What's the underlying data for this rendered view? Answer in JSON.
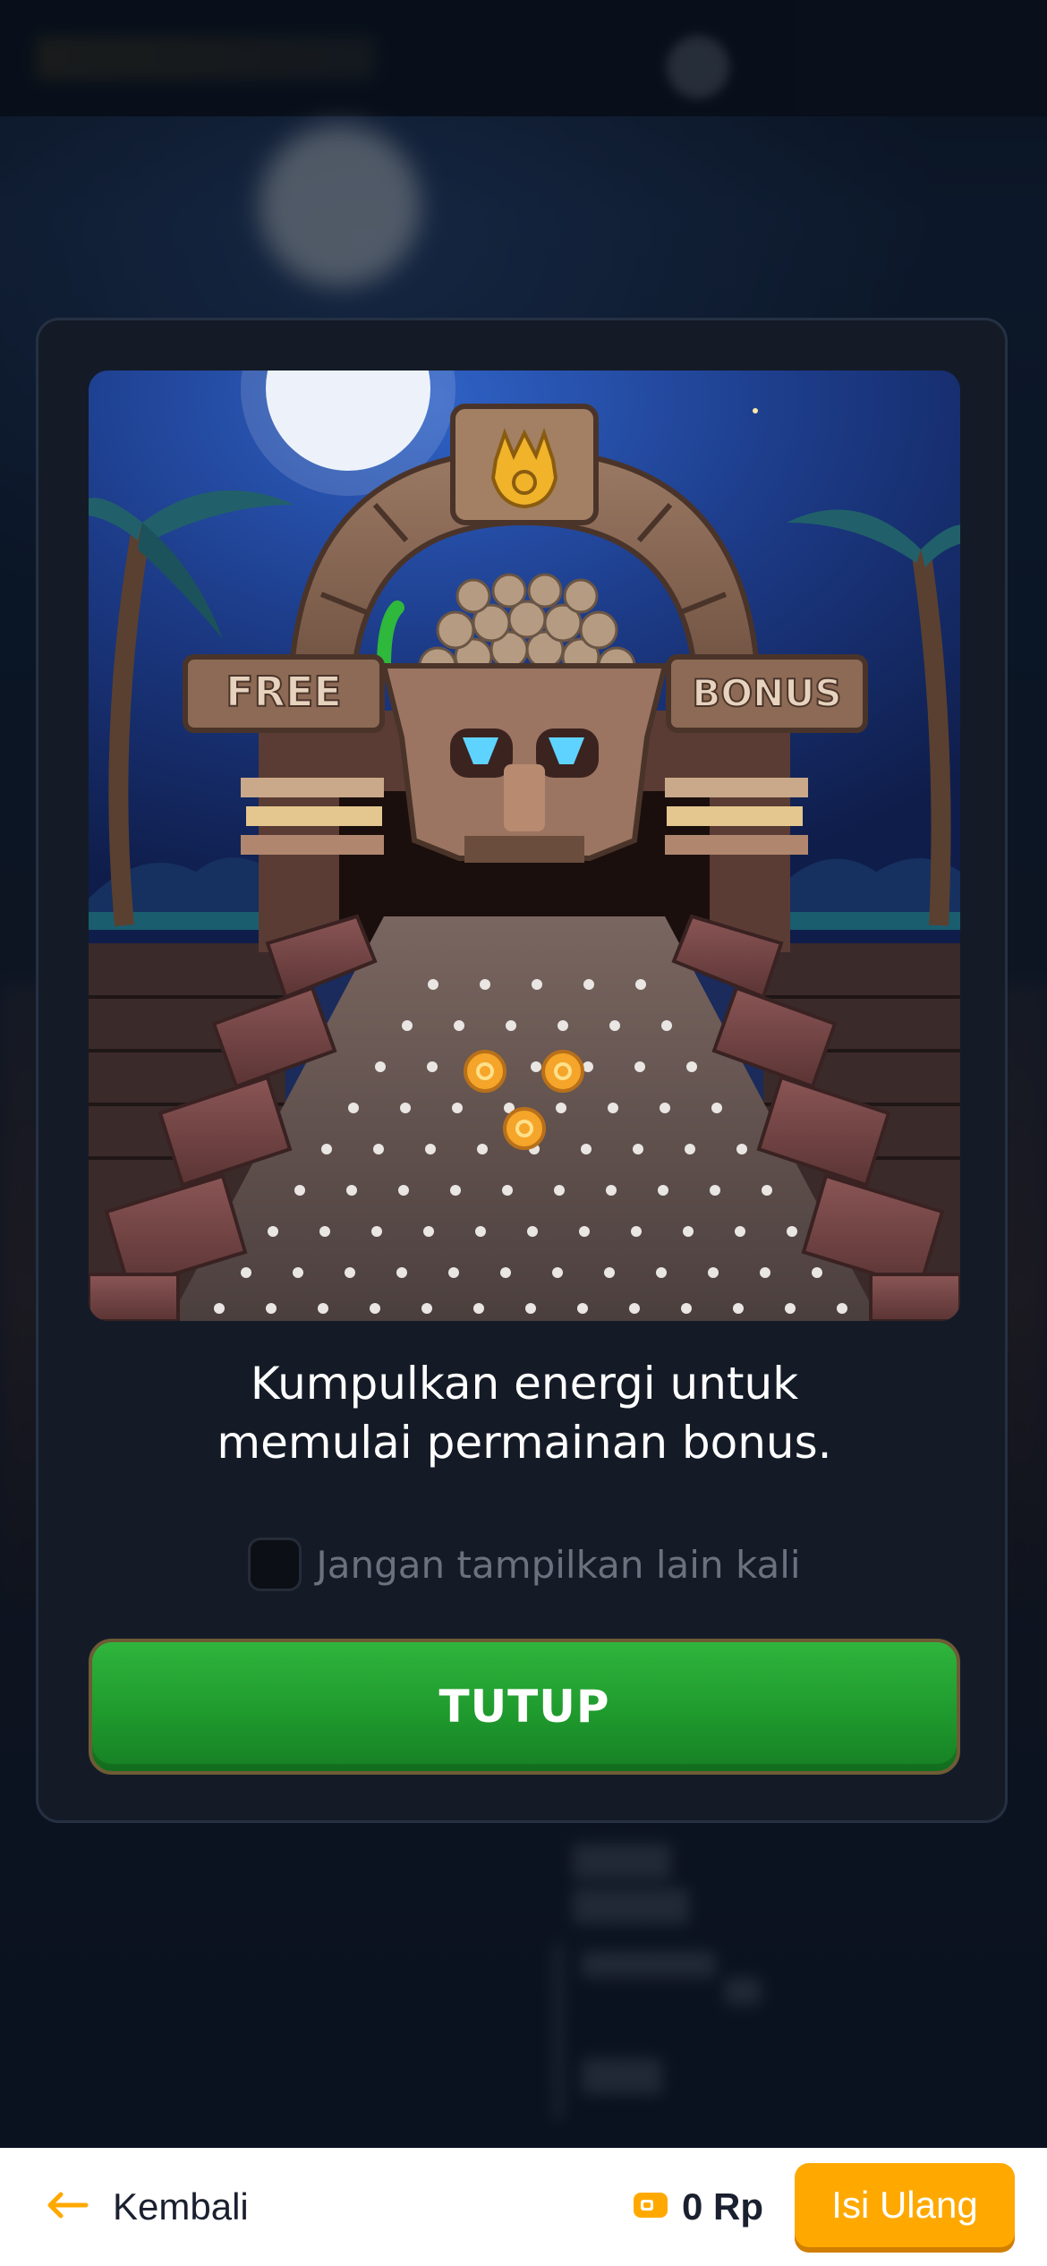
{
  "modal": {
    "message_line1": "Kumpulkan energi untuk",
    "message_line2": "memulai permainan bonus.",
    "checkbox_label": "Jangan tampilkan lain kali",
    "checkbox_checked": false,
    "close_button_label": "TUTUP",
    "art": {
      "sign_left": "FREE",
      "sign_right": "BONUS"
    }
  },
  "bottom_bar": {
    "back_label": "Kembali",
    "balance": "0 Rp",
    "topup_label": "Isi Ulang"
  },
  "colors": {
    "accent": "#ffa900",
    "primary_button": "#1f9a2d",
    "modal_background": "#141b27"
  },
  "icons": {
    "back": "arrow-left-icon",
    "wallet": "wallet-icon"
  }
}
